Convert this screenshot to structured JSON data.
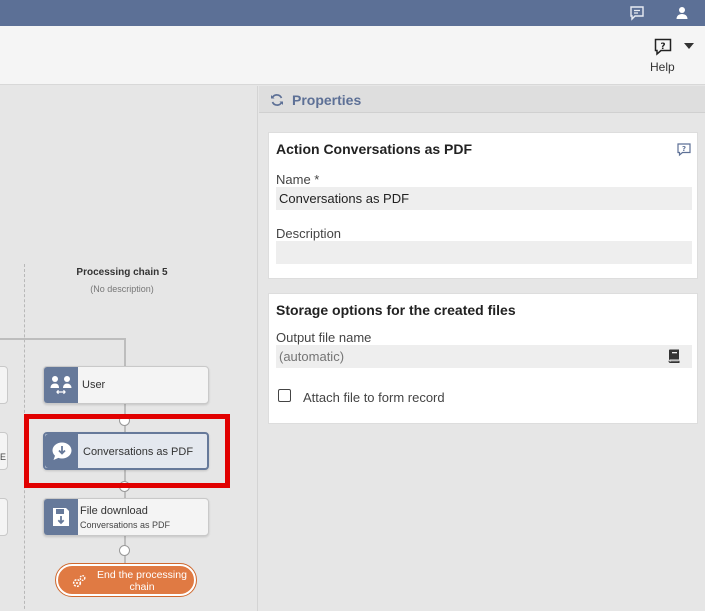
{
  "topbar": {
    "icons": [
      "chat-icon",
      "user-icon"
    ]
  },
  "toolbar": {
    "help_label": "Help"
  },
  "colors": {
    "topbar": "#5c7096",
    "accent": "#5d7096",
    "end_button": "#e07a43",
    "highlight": "#e10000"
  },
  "canvas": {
    "chain_title": "Processing chain 5",
    "chain_description": "(No description)",
    "left_fragment_letter": "E",
    "nodes": [
      {
        "title": "User",
        "subtitle": "",
        "icon": "user-exchange-icon"
      },
      {
        "title": "Conversations as PDF",
        "subtitle": "",
        "icon": "chat-download-icon",
        "selected": true
      },
      {
        "title": "File download",
        "subtitle": "Conversations as PDF",
        "icon": "floppy-download-icon"
      }
    ],
    "end_button_label": "End the processing chain"
  },
  "properties": {
    "title": "Properties",
    "action_card": {
      "heading": "Action Conversations as PDF",
      "name_label": "Name  *",
      "name_value": "Conversations as PDF",
      "description_label": "Description",
      "description_value": ""
    },
    "storage_card": {
      "heading": "Storage options for the created files",
      "output_label": "Output file name",
      "output_placeholder": "(automatic)",
      "attach_label": "Attach file to form record",
      "attach_checked": false
    }
  }
}
